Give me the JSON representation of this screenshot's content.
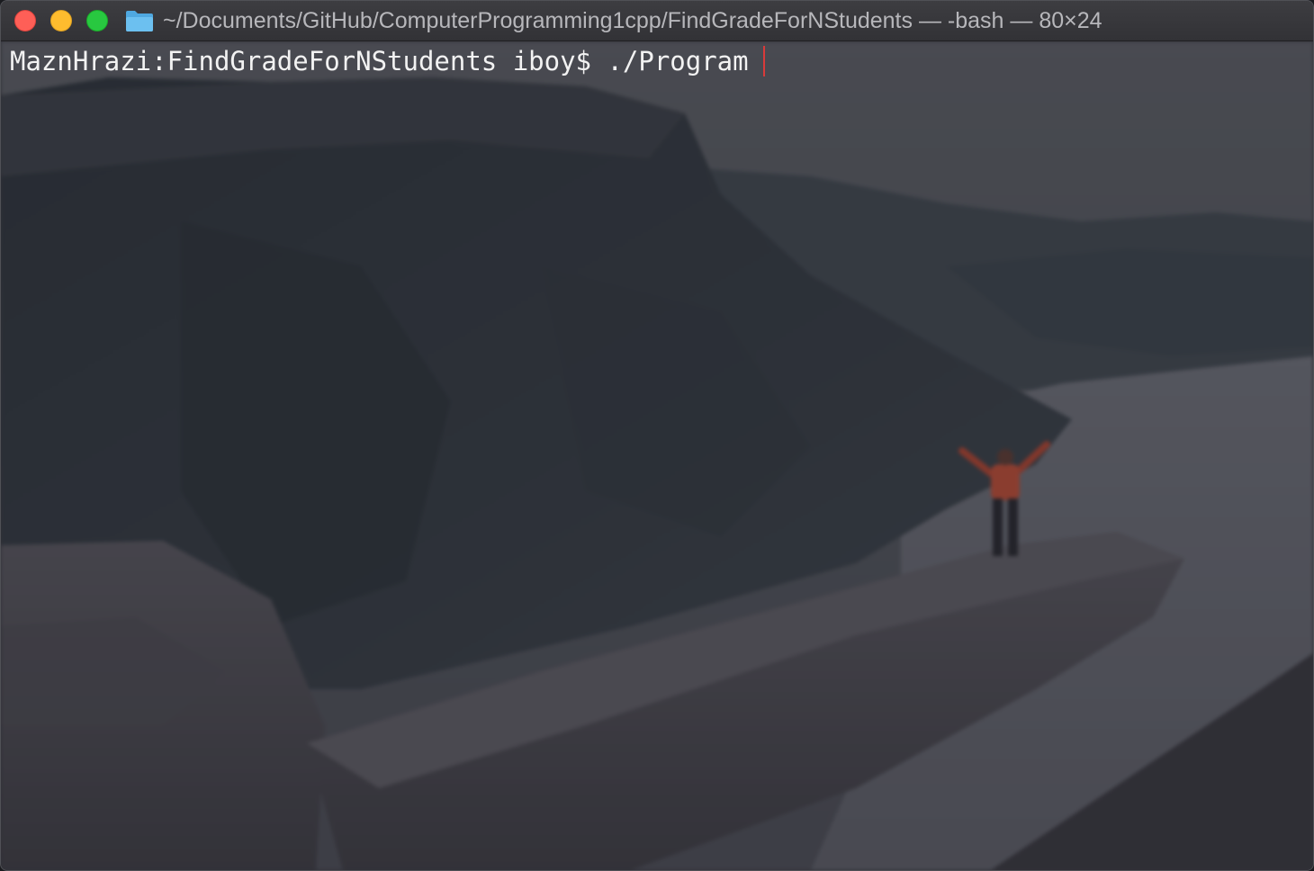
{
  "window": {
    "title": "~/Documents/GitHub/ComputerProgramming1cpp/FindGradeForNStudents — -bash — 80×24",
    "folder_icon": "folder-icon",
    "controls": {
      "close": "close-button",
      "minimize": "minimize-button",
      "zoom": "zoom-button"
    }
  },
  "terminal": {
    "prompt": "MaznHrazi:FindGradeForNStudents iboy$ ",
    "command": "./Program",
    "cursor_color": "#d93a3a"
  },
  "background": {
    "description_icon": "mountain-fjord-wallpaper",
    "accent": "#c8462f"
  }
}
